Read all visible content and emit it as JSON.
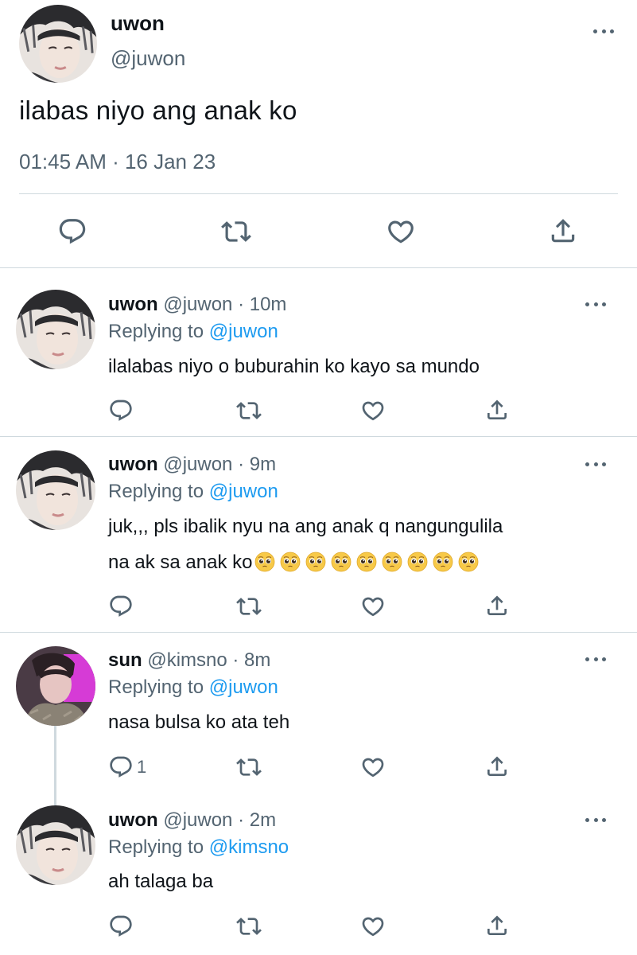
{
  "main_tweet": {
    "name": "uwon",
    "handle": "@juwon",
    "text": "ilabas niyo ang anak ko",
    "timestamp": "01:45 AM · 16 Jan 23"
  },
  "replies": [
    {
      "name": "uwon",
      "meta": "@juwon · 10m",
      "replying_prefix": "Replying to ",
      "replying_to": "@juwon",
      "text": "ilalabas niyo o buburahin ko kayo sa mundo",
      "reply_count": ""
    },
    {
      "name": "uwon",
      "meta": "@juwon · 9m",
      "replying_prefix": "Replying to ",
      "replying_to": "@juwon",
      "text_line1": "juk,,, pls ibalik nyu na ang anak q nangungulila",
      "text_line2": "na ak sa anak ko",
      "emoji_count": 9,
      "reply_count": ""
    },
    {
      "name": "sun",
      "meta": "@kimsno · 8m",
      "replying_prefix": "Replying to ",
      "replying_to": "@juwon",
      "text": "nasa bulsa ko ata teh",
      "reply_count": "1"
    },
    {
      "name": "uwon",
      "meta": "@juwon · 2m",
      "replying_prefix": "Replying to ",
      "replying_to": "@kimsno",
      "text": "ah talaga ba",
      "reply_count": ""
    }
  ],
  "icons": [
    "reply-icon",
    "retweet-icon",
    "like-icon",
    "share-icon",
    "more-icon",
    "pleading-face-emoji"
  ],
  "colors": {
    "text": "#0f1419",
    "secondary": "#536471",
    "link": "#1d9bf0",
    "divider": "#cfd9de"
  }
}
